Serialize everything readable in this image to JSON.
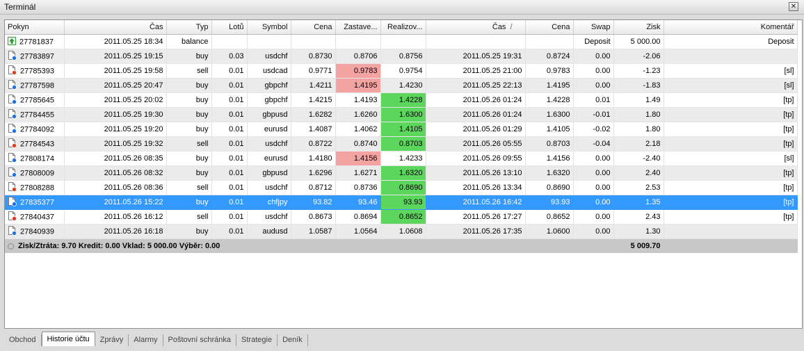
{
  "window": {
    "title": "Terminál"
  },
  "columns": [
    "Pokyn",
    "Čas",
    "Typ",
    "Lotů",
    "Symbol",
    "Cena",
    "Zastave...",
    "Realizov...",
    "Čas",
    "Cena",
    "Swap",
    "Zisk",
    "Komentář"
  ],
  "sort_indicator": "/",
  "rows": [
    {
      "order": "27781837",
      "open_time": "2011.05.25 18:34",
      "type": "balance",
      "lots": "",
      "symbol": "",
      "price": "",
      "sl": "",
      "tp": "",
      "close_time": "",
      "close_price": "",
      "swap": "Deposit",
      "profit": "5 000.00",
      "comment": "Deposit",
      "sl_hit": false,
      "tp_hit": false,
      "icon": "deposit-arrow"
    },
    {
      "order": "27783897",
      "open_time": "2011.05.25 19:15",
      "type": "buy",
      "lots": "0.03",
      "symbol": "usdchf",
      "price": "0.8730",
      "sl": "0.8706",
      "tp": "0.8756",
      "close_time": "2011.05.25 19:31",
      "close_price": "0.8724",
      "swap": "0.00",
      "profit": "-2.06",
      "comment": "",
      "sl_hit": false,
      "tp_hit": false,
      "icon": "order-buy"
    },
    {
      "order": "27785393",
      "open_time": "2011.05.25 19:58",
      "type": "sell",
      "lots": "0.01",
      "symbol": "usdcad",
      "price": "0.9771",
      "sl": "0.9783",
      "tp": "0.9754",
      "close_time": "2011.05.25 21:00",
      "close_price": "0.9783",
      "swap": "0.00",
      "profit": "-1.23",
      "comment": "[sl]",
      "sl_hit": true,
      "tp_hit": false,
      "icon": "order-sell"
    },
    {
      "order": "27787598",
      "open_time": "2011.05.25 20:47",
      "type": "buy",
      "lots": "0.01",
      "symbol": "gbpchf",
      "price": "1.4211",
      "sl": "1.4195",
      "tp": "1.4230",
      "close_time": "2011.05.25 22:13",
      "close_price": "1.4195",
      "swap": "0.00",
      "profit": "-1.83",
      "comment": "[sl]",
      "sl_hit": true,
      "tp_hit": false,
      "icon": "order-buy"
    },
    {
      "order": "27785645",
      "open_time": "2011.05.25 20:02",
      "type": "buy",
      "lots": "0.01",
      "symbol": "gbpchf",
      "price": "1.4215",
      "sl": "1.4193",
      "tp": "1.4228",
      "close_time": "2011.05.26 01:24",
      "close_price": "1.4228",
      "swap": "0.01",
      "profit": "1.49",
      "comment": "[tp]",
      "sl_hit": false,
      "tp_hit": true,
      "icon": "order-buy"
    },
    {
      "order": "27784455",
      "open_time": "2011.05.25 19:30",
      "type": "buy",
      "lots": "0.01",
      "symbol": "gbpusd",
      "price": "1.6282",
      "sl": "1.6260",
      "tp": "1.6300",
      "close_time": "2011.05.26 01:24",
      "close_price": "1.6300",
      "swap": "-0.01",
      "profit": "1.80",
      "comment": "[tp]",
      "sl_hit": false,
      "tp_hit": true,
      "icon": "order-buy"
    },
    {
      "order": "27784092",
      "open_time": "2011.05.25 19:20",
      "type": "buy",
      "lots": "0.01",
      "symbol": "eurusd",
      "price": "1.4087",
      "sl": "1.4062",
      "tp": "1.4105",
      "close_time": "2011.05.26 01:29",
      "close_price": "1.4105",
      "swap": "-0.02",
      "profit": "1.80",
      "comment": "[tp]",
      "sl_hit": false,
      "tp_hit": true,
      "icon": "order-buy"
    },
    {
      "order": "27784543",
      "open_time": "2011.05.25 19:32",
      "type": "sell",
      "lots": "0.01",
      "symbol": "usdchf",
      "price": "0.8722",
      "sl": "0.8740",
      "tp": "0.8703",
      "close_time": "2011.05.26 05:55",
      "close_price": "0.8703",
      "swap": "-0.04",
      "profit": "2.18",
      "comment": "[tp]",
      "sl_hit": false,
      "tp_hit": true,
      "icon": "order-sell"
    },
    {
      "order": "27808174",
      "open_time": "2011.05.26 08:35",
      "type": "buy",
      "lots": "0.01",
      "symbol": "eurusd",
      "price": "1.4180",
      "sl": "1.4156",
      "tp": "1.4233",
      "close_time": "2011.05.26 09:55",
      "close_price": "1.4156",
      "swap": "0.00",
      "profit": "-2.40",
      "comment": "[sl]",
      "sl_hit": true,
      "tp_hit": false,
      "icon": "order-buy"
    },
    {
      "order": "27808009",
      "open_time": "2011.05.26 08:32",
      "type": "buy",
      "lots": "0.01",
      "symbol": "gbpusd",
      "price": "1.6296",
      "sl": "1.6271",
      "tp": "1.6320",
      "close_time": "2011.05.26 13:10",
      "close_price": "1.6320",
      "swap": "0.00",
      "profit": "2.40",
      "comment": "[tp]",
      "sl_hit": false,
      "tp_hit": true,
      "icon": "order-buy"
    },
    {
      "order": "27808288",
      "open_time": "2011.05.26 08:36",
      "type": "sell",
      "lots": "0.01",
      "symbol": "usdchf",
      "price": "0.8712",
      "sl": "0.8736",
      "tp": "0.8690",
      "close_time": "2011.05.26 13:34",
      "close_price": "0.8690",
      "swap": "0.00",
      "profit": "2.53",
      "comment": "[tp]",
      "sl_hit": false,
      "tp_hit": true,
      "icon": "order-sell"
    },
    {
      "order": "27835377",
      "open_time": "2011.05.26 15:22",
      "type": "buy",
      "lots": "0.01",
      "symbol": "chfjpy",
      "price": "93.82",
      "sl": "93.46",
      "tp": "93.93",
      "close_time": "2011.05.26 16:42",
      "close_price": "93.93",
      "swap": "0.00",
      "profit": "1.35",
      "comment": "[tp]",
      "sl_hit": false,
      "tp_hit": true,
      "icon": "order-buy",
      "selected": true
    },
    {
      "order": "27840437",
      "open_time": "2011.05.26 16:12",
      "type": "sell",
      "lots": "0.01",
      "symbol": "usdchf",
      "price": "0.8673",
      "sl": "0.8694",
      "tp": "0.8652",
      "close_time": "2011.05.26 17:27",
      "close_price": "0.8652",
      "swap": "0.00",
      "profit": "2.43",
      "comment": "[tp]",
      "sl_hit": false,
      "tp_hit": true,
      "icon": "order-sell"
    },
    {
      "order": "27840939",
      "open_time": "2011.05.26 16:18",
      "type": "buy",
      "lots": "0.01",
      "symbol": "audusd",
      "price": "1.0587",
      "sl": "1.0564",
      "tp": "1.0608",
      "close_time": "2011.05.26 17:35",
      "close_price": "1.0600",
      "swap": "0.00",
      "profit": "1.30",
      "comment": "",
      "sl_hit": false,
      "tp_hit": false,
      "icon": "order-buy"
    }
  ],
  "summary": {
    "text": "Zisk/Ztráta: 9.70  Kredit: 0.00  Vklad: 5 000.00  Výběr: 0.00",
    "total": "5 009.70"
  },
  "tabs": [
    {
      "label": "Obchod",
      "active": false
    },
    {
      "label": "Historie účtu",
      "active": true
    },
    {
      "label": "Zprávy",
      "active": false
    },
    {
      "label": "Alarmy",
      "active": false
    },
    {
      "label": "Poštovní schránka",
      "active": false
    },
    {
      "label": "Strategie",
      "active": false
    },
    {
      "label": "Deník",
      "active": false
    }
  ],
  "colors": {
    "selected_row": "#3399ff",
    "sl_highlight": "#f4a3a3",
    "tp_highlight": "#5dd65d",
    "buy_icon": "#1e6fd9",
    "sell_icon": "#e03a1e",
    "deposit_icon": "#2a9d2a"
  }
}
